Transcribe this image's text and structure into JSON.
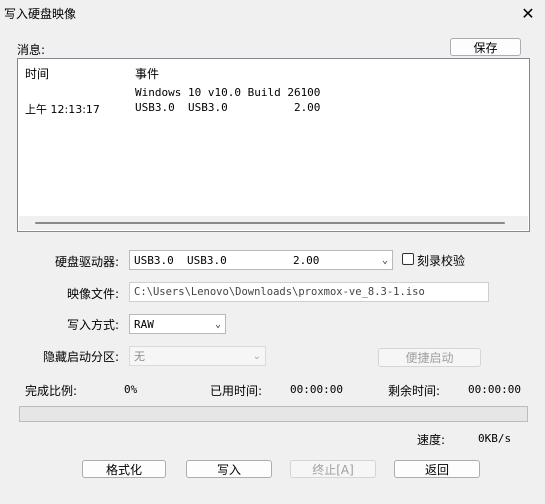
{
  "window": {
    "title": "写入硬盘映像",
    "close_glyph": "✕"
  },
  "messages": {
    "label": "消息:",
    "save_button": "保存",
    "columns": [
      "时间",
      "事件"
    ],
    "rows": [
      {
        "time": "",
        "event": "Windows 10 v10.0 Build 26100"
      },
      {
        "time": "上午 12:13:17",
        "event": "USB3.0  USB3.0          2.00"
      }
    ]
  },
  "form": {
    "drive_label": "硬盘驱动器:",
    "drive_value": "USB3.0  USB3.0          2.00",
    "verify_label": "刻录校验",
    "verify_checked": false,
    "image_label": "映像文件:",
    "image_value": "C:\\Users\\Lenovo\\Downloads\\proxmox-ve_8.3-1.iso",
    "method_label": "写入方式:",
    "method_value": "RAW",
    "hidden_label": "隐藏启动分区:",
    "hidden_value": "无",
    "quick_boot_button": "便捷启动"
  },
  "status": {
    "percent_label": "完成比例:",
    "percent_value": "0%",
    "elapsed_label": "已用时间:",
    "elapsed_value": "00:00:00",
    "remaining_label": "剩余时间:",
    "remaining_value": "00:00:00",
    "progress": 0,
    "speed_label": "速度:",
    "speed_value": "0KB/s"
  },
  "buttons": {
    "format": "格式化",
    "write": "写入",
    "stop": "终止[A]",
    "back": "返回"
  }
}
